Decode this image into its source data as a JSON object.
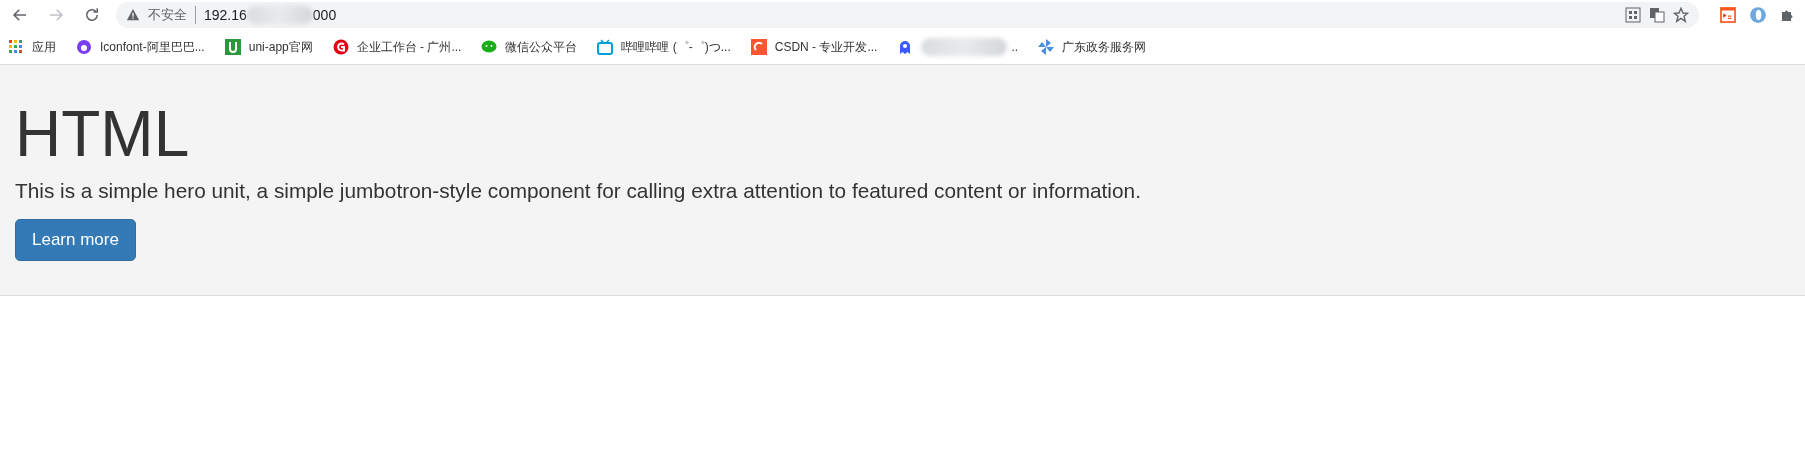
{
  "address_bar": {
    "security": "不安全",
    "url_start": "192.16",
    "url_end": "000"
  },
  "bookmarks": [
    {
      "label": "应用",
      "kind": "plain"
    },
    {
      "label": "Iconfont-阿里巴巴...",
      "kind": "plain"
    },
    {
      "label": "uni-app官网",
      "kind": "plain"
    },
    {
      "label": "企业工作台 - 广州...",
      "kind": "plain"
    },
    {
      "label": "微信公众平台",
      "kind": "plain"
    },
    {
      "label": "哔哩哔哩 (゜-゜)つ...",
      "kind": "plain"
    },
    {
      "label": "CSDN - 专业开发...",
      "kind": "plain"
    },
    {
      "label": "..",
      "kind": "blurred"
    },
    {
      "label": "广东政务服务网",
      "kind": "plain"
    }
  ],
  "hero": {
    "title": "HTML",
    "text": "This is a simple hero unit, a simple jumbotron-style component for calling extra attention to featured content or information.",
    "button": "Learn more"
  }
}
